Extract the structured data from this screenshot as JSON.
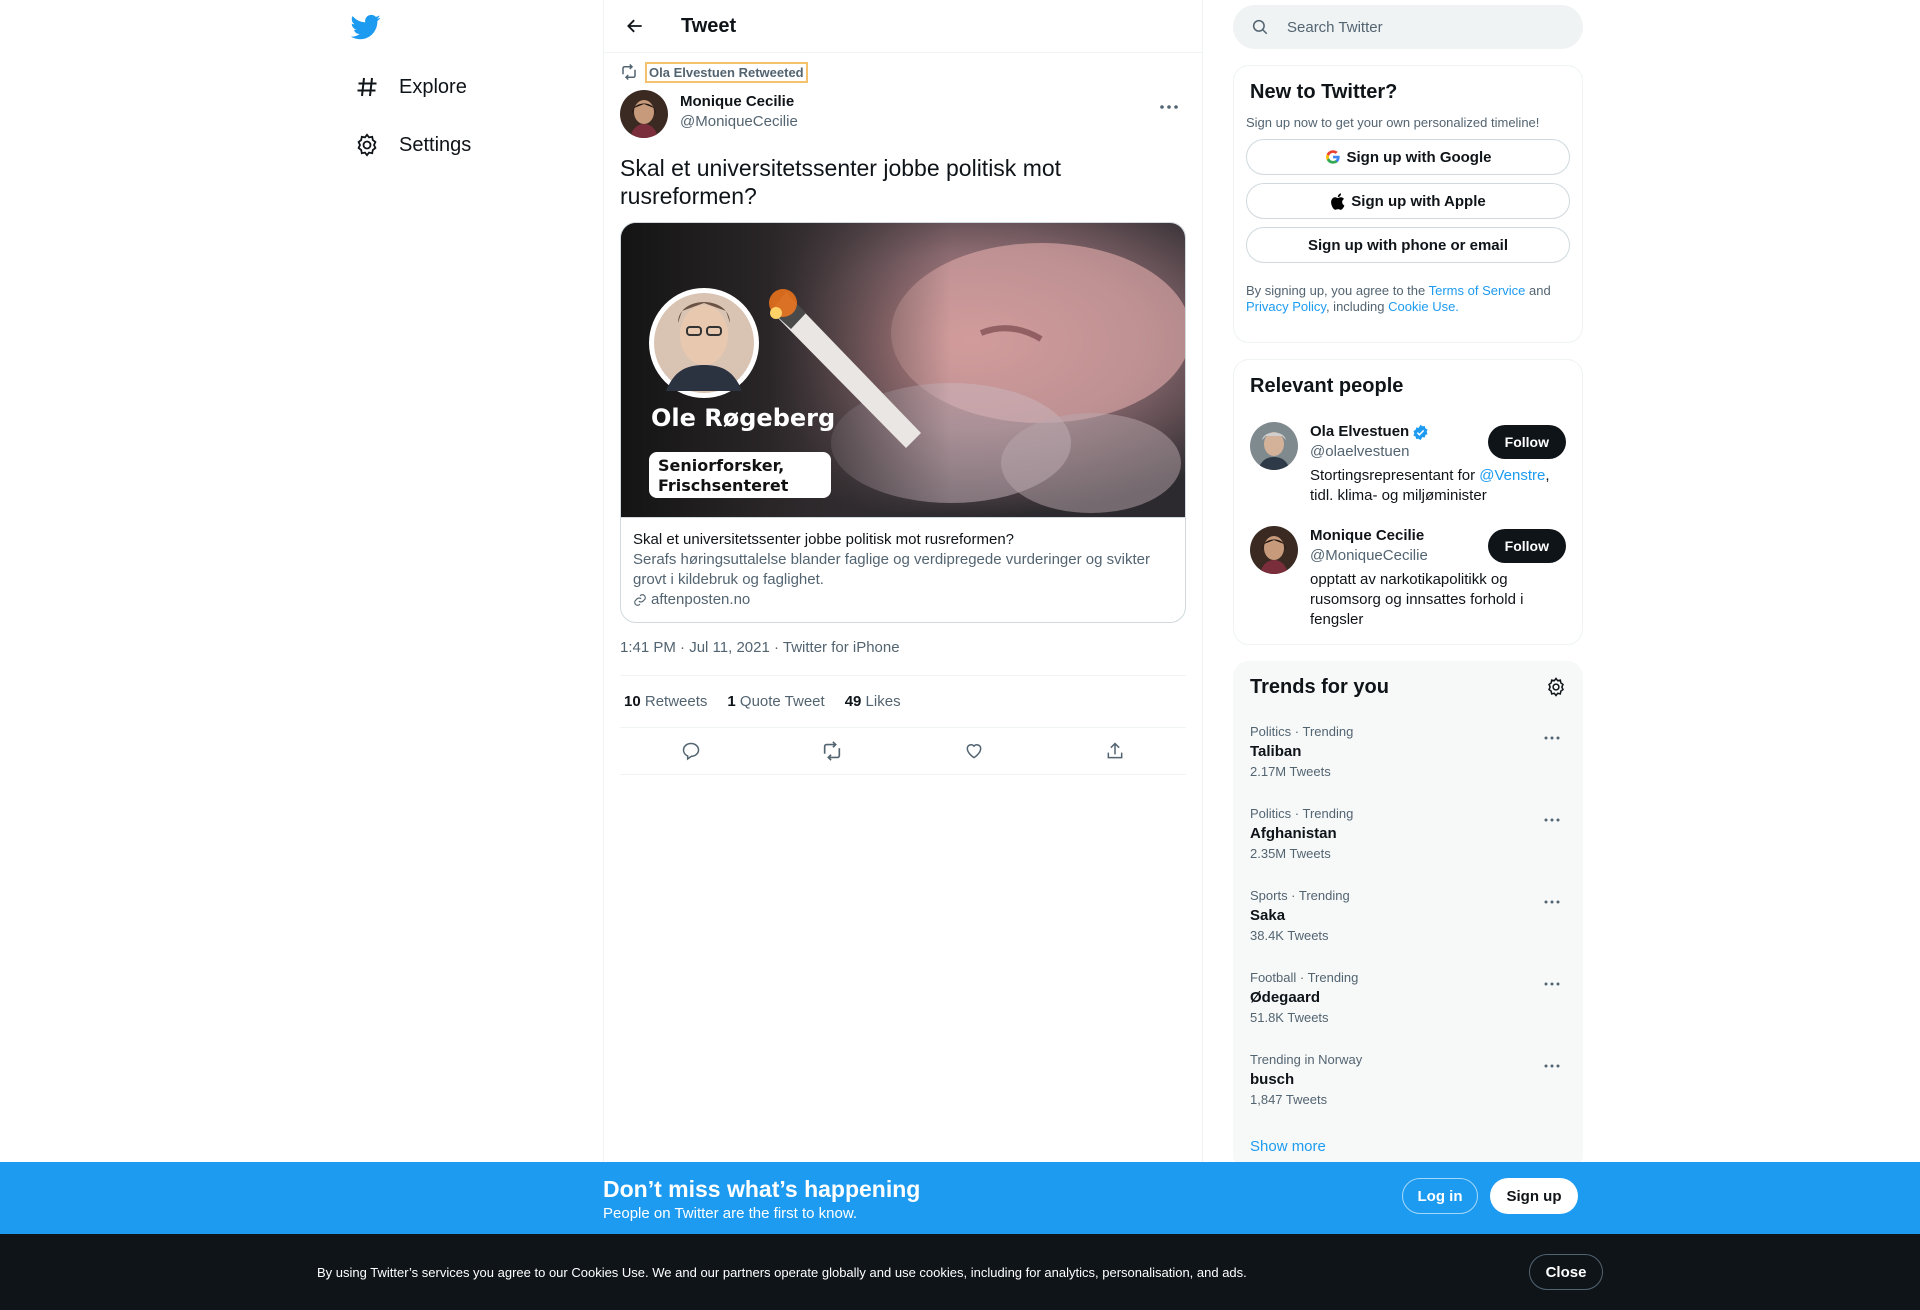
{
  "nav": {
    "logo_icon": "twitter-bird-icon",
    "items": [
      {
        "label": "Explore",
        "icon": "hashtag-icon"
      },
      {
        "label": "Settings",
        "icon": "gear-icon"
      }
    ]
  },
  "header": {
    "title": "Tweet"
  },
  "tweet": {
    "retweeted_by": "Ola Elvestuen Retweeted",
    "author_name": "Monique Cecilie",
    "author_handle": "@MoniqueCecilie",
    "text": "Skal et universitetssenter jobbe politisk mot rusreformen?",
    "card": {
      "image_name": "Ole Røgeberg",
      "image_title_line1": "Seniorforsker,",
      "image_title_line2": "Frischsenteret",
      "title": "Skal et universitetssenter jobbe politisk mot rusreformen?",
      "description": "Serafs høringsuttalelse blander faglige og verdipregede vurderinger og svikter grovt i kildebruk og faglighet.",
      "domain": "aftenposten.no"
    },
    "meta": "1:41 PM · Jul 11, 2021 · Twitter for iPhone",
    "stats": {
      "retweets_count": "10",
      "retweets_label": "Retweets",
      "quotes_count": "1",
      "quotes_label": "Quote Tweet",
      "likes_count": "49",
      "likes_label": "Likes"
    }
  },
  "search": {
    "placeholder": "Search Twitter"
  },
  "new_to_twitter": {
    "title": "New to Twitter?",
    "subtitle": "Sign up now to get your own personalized timeline!",
    "google": "Sign up with Google",
    "apple": "Sign up with Apple",
    "phone": "Sign up with phone or email",
    "legal_prefix": "By signing up, you agree to the ",
    "terms": "Terms of Service",
    "and": " and ",
    "privacy": "Privacy Policy",
    "including": ", including ",
    "cookie": "Cookie Use."
  },
  "relevant": {
    "title": "Relevant people",
    "people": [
      {
        "name": "Ola Elvestuen",
        "handle": "@olaelvestuen",
        "bio_prefix": "Stortingsrepresentant for ",
        "bio_link": "@Venstre",
        "bio_suffix": ", tidl. klima- og miljøminister",
        "follow": "Follow"
      },
      {
        "name": "Monique Cecilie",
        "handle": "@MoniqueCecilie",
        "bio": "opptatt av narkotikapolitikk og rusomsorg og innsattes forhold i fengsler",
        "follow": "Follow"
      }
    ]
  },
  "trends": {
    "title": "Trends for you",
    "items": [
      {
        "meta": "Politics · Trending",
        "name": "Taliban",
        "count": "2.17M Tweets"
      },
      {
        "meta": "Politics · Trending",
        "name": "Afghanistan",
        "count": "2.35M Tweets"
      },
      {
        "meta": "Sports · Trending",
        "name": "Saka",
        "count": "38.4K Tweets"
      },
      {
        "meta": "Football · Trending",
        "name": "Ødegaard",
        "count": "51.8K Tweets"
      },
      {
        "meta": "Trending in Norway",
        "name": "busch",
        "count": "1,847 Tweets"
      }
    ],
    "show_more": "Show more"
  },
  "promo": {
    "title": "Don’t miss what’s happening",
    "subtitle": "People on Twitter are the first to know.",
    "login": "Log in",
    "signup": "Sign up"
  },
  "cookie": {
    "text": "By using Twitter’s services you agree to our Cookies Use. We and our partners operate globally and use cookies, including for analytics, personalisation, and ads.",
    "close": "Close"
  },
  "colors": {
    "accent": "#1d9bf0",
    "text": "#0f1419",
    "secondary": "#536471",
    "border": "#eff3f4"
  }
}
